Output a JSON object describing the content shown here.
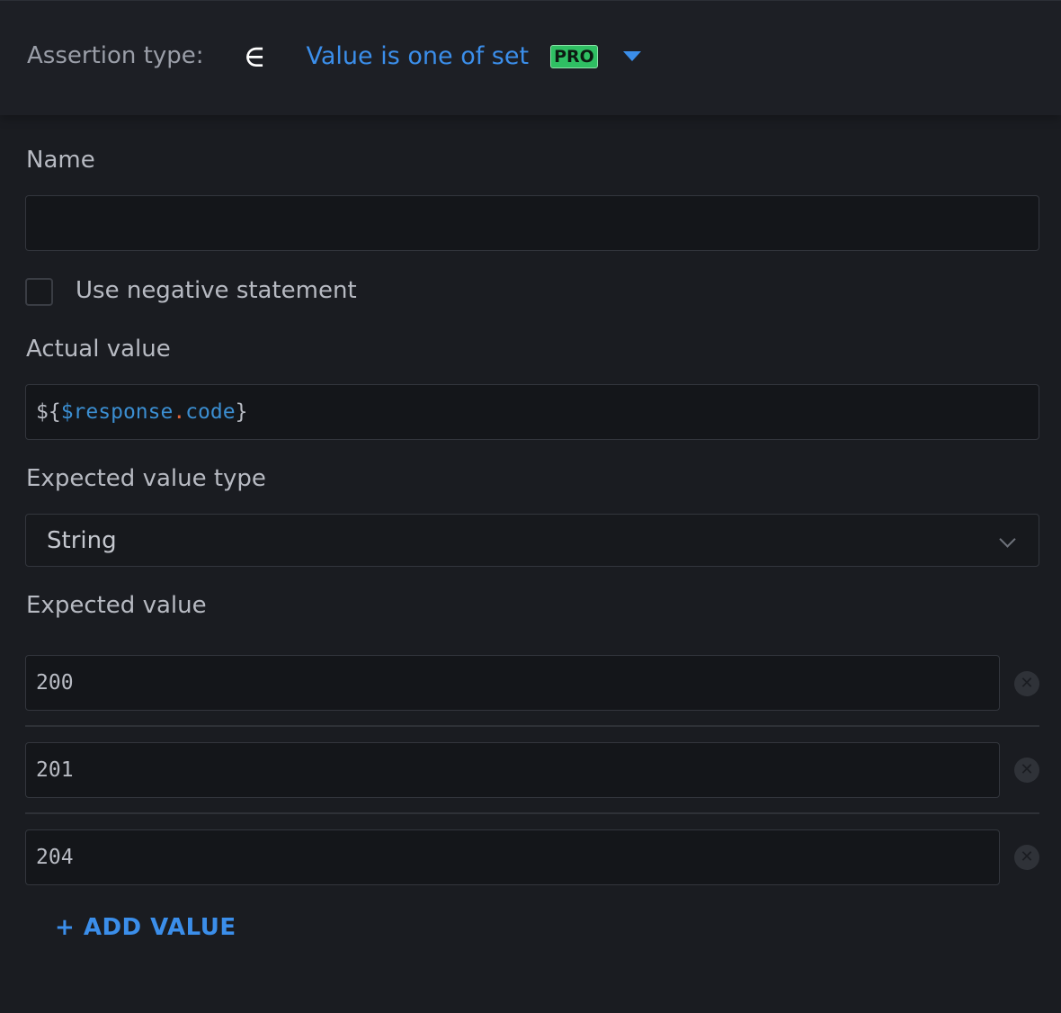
{
  "header": {
    "assertion_label": "Assertion type:",
    "type_icon": "∈",
    "type_label": "Value is one of set",
    "pro_badge": "PRO"
  },
  "form": {
    "name_label": "Name",
    "name_value": "",
    "negative_label": "Use negative statement",
    "negative_checked": false,
    "actual_label": "Actual value",
    "actual_value": {
      "prefix": "${",
      "var": "$response",
      "dot": ".",
      "prop": "code",
      "suffix": "}"
    },
    "expected_type_label": "Expected value type",
    "expected_type_value": "String",
    "expected_value_label": "Expected value",
    "values": [
      "200",
      "201",
      "204"
    ],
    "add_label": "+ ADD VALUE"
  },
  "colors": {
    "background": "#1a1c21",
    "accent": "#3b8eea",
    "pro": "#2fbf63"
  }
}
